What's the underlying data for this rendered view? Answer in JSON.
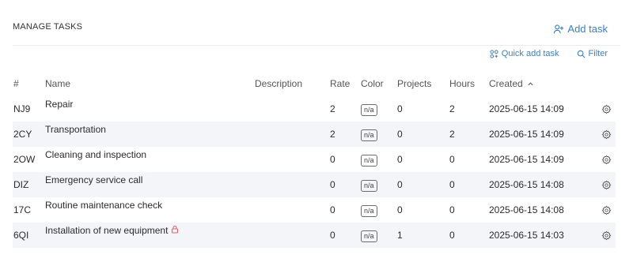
{
  "header": {
    "title": "MANAGE TASKS",
    "add_task_label": "Add task"
  },
  "toolbar": {
    "quick_add_label": "Quick add task",
    "filter_label": "Filter"
  },
  "table": {
    "columns": {
      "id": "#",
      "name": "Name",
      "description": "Description",
      "rate": "Rate",
      "color": "Color",
      "projects": "Projects",
      "hours": "Hours",
      "created": "Created"
    },
    "sort": {
      "column": "created",
      "direction": "ascending"
    },
    "rows": [
      {
        "id": "NJ9",
        "name": "Repair",
        "description": "",
        "rate": "2",
        "color": "n/a",
        "projects": "0",
        "hours": "2",
        "created": "2025-06-15 14:09",
        "locked": false
      },
      {
        "id": "2CY",
        "name": "Transportation",
        "description": "",
        "rate": "2",
        "color": "n/a",
        "projects": "0",
        "hours": "2",
        "created": "2025-06-15 14:09",
        "locked": false
      },
      {
        "id": "2OW",
        "name": "Cleaning and inspection",
        "description": "",
        "rate": "0",
        "color": "n/a",
        "projects": "0",
        "hours": "0",
        "created": "2025-06-15 14:09",
        "locked": false
      },
      {
        "id": "DIZ",
        "name": "Emergency service call",
        "description": "",
        "rate": "0",
        "color": "n/a",
        "projects": "0",
        "hours": "0",
        "created": "2025-06-15 14:08",
        "locked": false
      },
      {
        "id": "17C",
        "name": "Routine maintenance check",
        "description": "",
        "rate": "0",
        "color": "n/a",
        "projects": "0",
        "hours": "0",
        "created": "2025-06-15 14:08",
        "locked": false
      },
      {
        "id": "6QI",
        "name": "Installation of new equipment",
        "description": "",
        "rate": "0",
        "color": "n/a",
        "projects": "1",
        "hours": "0",
        "created": "2025-06-15 14:03",
        "locked": true
      }
    ]
  },
  "colors": {
    "accent": "#3d7fc1",
    "lock": "#e0606a",
    "row_alt": "#f4f5f8"
  },
  "icons": {
    "add_task": "user-plus-icon",
    "quick_add": "grid-plus-icon",
    "filter": "search-icon",
    "sort": "chevron-up-icon",
    "row_action": "gear-icon",
    "locked": "lock-icon"
  }
}
